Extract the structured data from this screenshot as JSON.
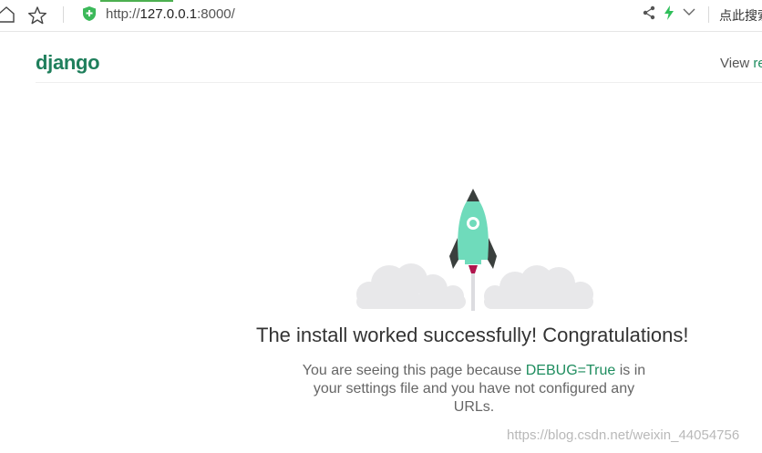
{
  "browser": {
    "url_prefix": "http://",
    "url_host": "127.0.0.1",
    "url_suffix": ":8000/",
    "search_label": "点此搜索"
  },
  "header": {
    "logo": "django",
    "release_link_prefix": "View ",
    "release_link_accent": "re"
  },
  "main": {
    "headline": "The install worked successfully! Congratulations!",
    "desc_part1": "You are seeing this page because ",
    "desc_code": "DEBUG=True",
    "desc_part2": " is in your settings file and you have not configured any URLs."
  },
  "watermark": "https://blog.csdn.net/weixin_44054756",
  "colors": {
    "django_green": "#1f7f5c",
    "rocket_body": "#6fdbbb",
    "cloud": "#e8e8ea"
  }
}
